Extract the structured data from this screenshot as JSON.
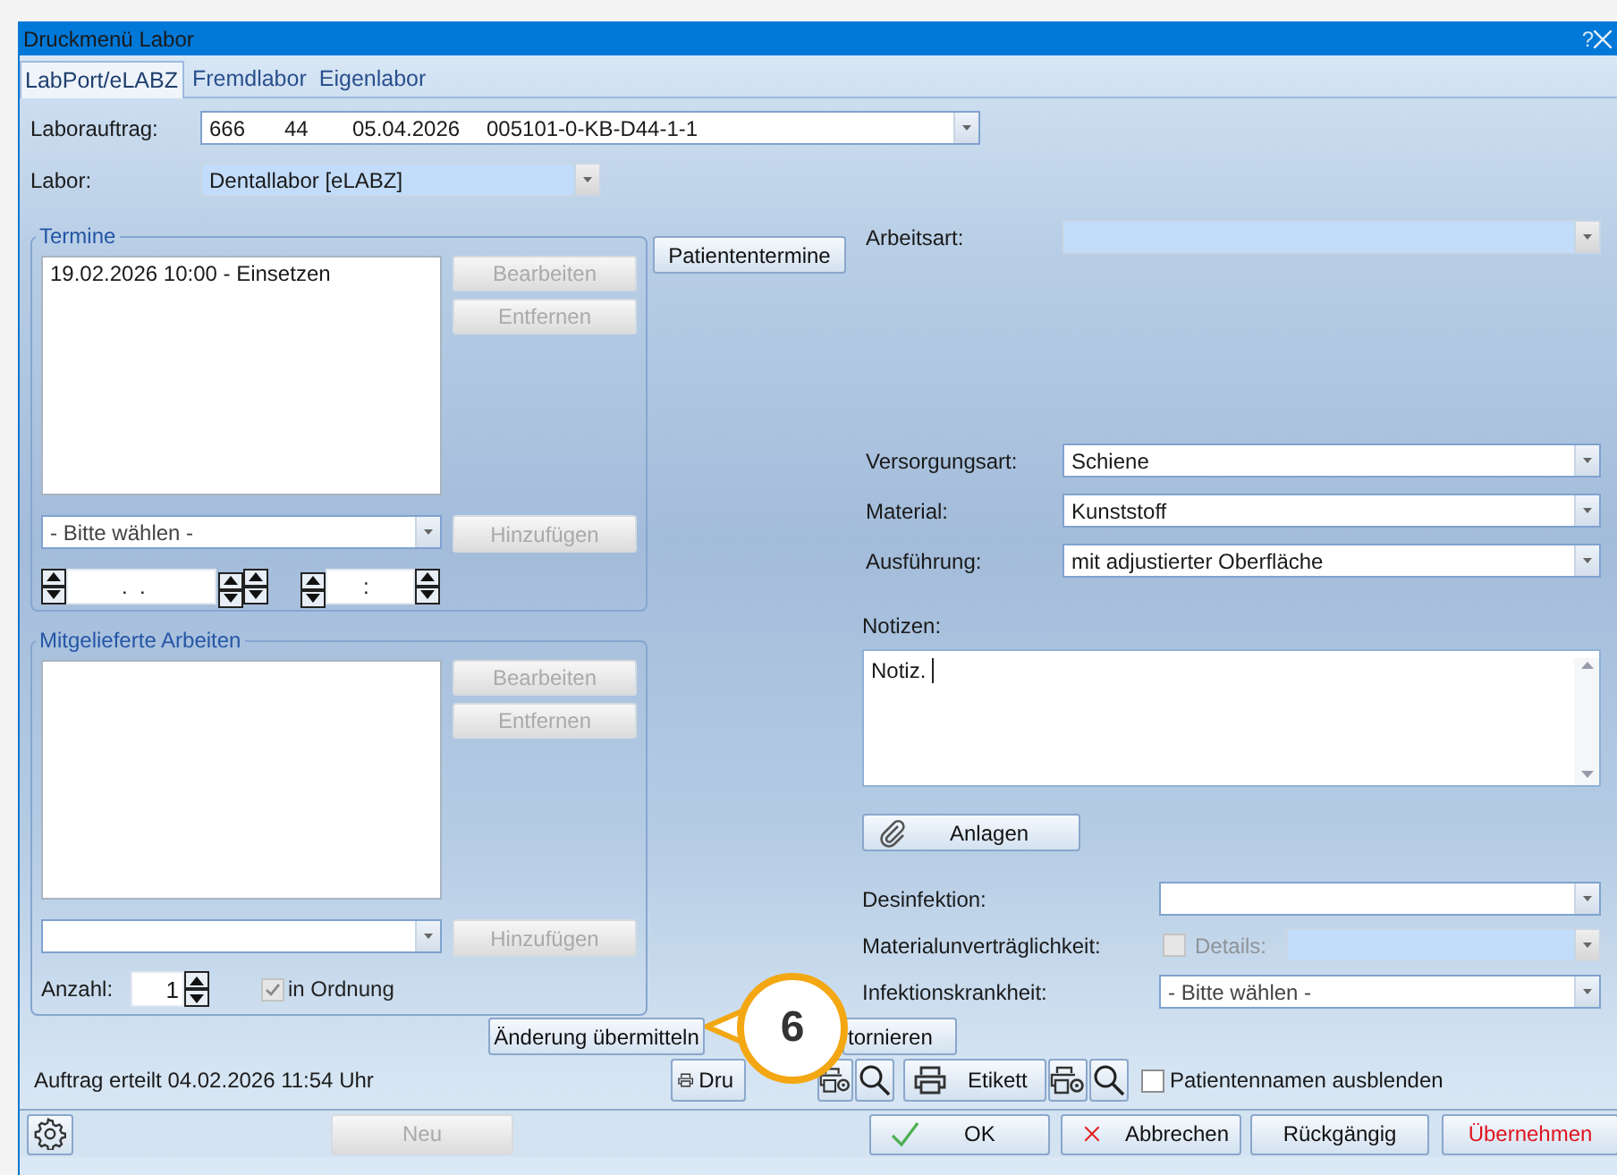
{
  "window": {
    "title": "Druckmenü Labor",
    "help": "?"
  },
  "tabs": [
    {
      "label": "LabPort/eLABZ",
      "selected": true
    },
    {
      "label": "Fremdlabor",
      "selected": false
    },
    {
      "label": "Eigenlabor",
      "selected": false
    }
  ],
  "order": {
    "label": "Laborauftrag:",
    "values": [
      "666",
      "44",
      "05.04.2026",
      "005101-0-KB-D44-1-1"
    ]
  },
  "lab": {
    "label": "Labor:",
    "value": "Dentallabor [eLABZ]",
    "disabled": true
  },
  "appointments": {
    "title": "Termine",
    "items": [
      {
        "text": "19.02.2026 10:00 - Einsetzen",
        "selected": false
      }
    ],
    "buttons": [
      {
        "label": "Bearbeiten",
        "disabled": true
      },
      {
        "label": "Entfernen",
        "disabled": true
      }
    ],
    "select": "- Bitte wählen -",
    "add": {
      "label": "Hinzufügen",
      "disabled": true
    },
    "date": ".  .",
    "time": ":"
  },
  "patient_appointments": "Patiententermine",
  "delivered": {
    "title": "Mitgelieferte Arbeiten",
    "buttons": [
      {
        "label": "Bearbeiten",
        "disabled": true
      },
      {
        "label": "Entfernen",
        "disabled": true
      }
    ],
    "add": {
      "label": "Hinzufügen",
      "disabled": true
    },
    "count": {
      "label": "Anzahl:",
      "value": "1"
    },
    "ok_check": {
      "label": "in Ordnung",
      "checked": true,
      "disabled": true
    }
  },
  "work_type": {
    "label": "Arbeitsart:",
    "disabled": true
  },
  "details": [
    {
      "label": "Versorgungsart:",
      "value": "Schiene"
    },
    {
      "label": "Material:",
      "value": "Kunststoff"
    },
    {
      "label": "Ausführung:",
      "value": "mit adjustierter Oberfläche"
    }
  ],
  "notes": {
    "label": "Notizen:",
    "value": "Notiz."
  },
  "attachments": "Anlagen",
  "hygiene": [
    {
      "kind": "select",
      "label": "Desinfektion:"
    },
    {
      "kind": "check_select",
      "label": "Materialunverträglichkeit:",
      "check_label": "Details:",
      "checked": false,
      "disabled": true
    },
    {
      "kind": "select",
      "label": "Infektionskrankheit:",
      "value": "- Bitte wählen -"
    }
  ],
  "actions": [
    "Änderung übermitteln",
    "tornieren"
  ],
  "status": "Auftrag erteilt 04.02.2026 11:54 Uhr",
  "print": {
    "print_button": "Dru",
    "label_button": "Etikett",
    "hide_names": {
      "label": "Patientennamen ausblenden",
      "checked": false
    }
  },
  "footer": [
    {
      "label": "Neu",
      "kind": "plain",
      "disabled": true
    },
    {
      "label": "OK",
      "kind": "ok",
      "disabled": false
    },
    {
      "label": "Abbrechen",
      "kind": "cancel",
      "disabled": false
    },
    {
      "label": "Rückgängig",
      "kind": "plain",
      "disabled": false
    },
    {
      "label": "Übernehmen",
      "kind": "apply",
      "disabled": false
    }
  ],
  "callout": "6"
}
